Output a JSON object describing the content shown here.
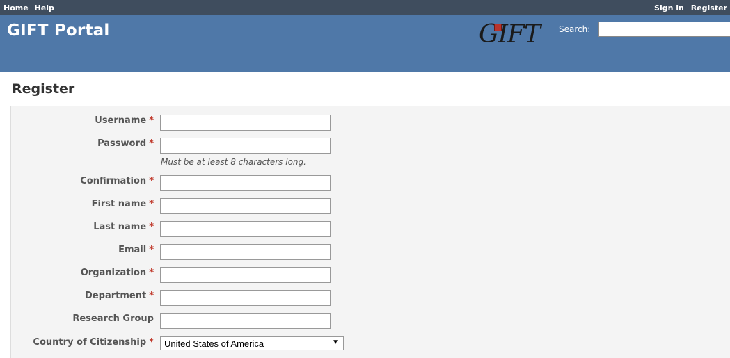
{
  "top_menu": {
    "home": "Home",
    "help": "Help",
    "sign_in": "Sign in",
    "register": "Register"
  },
  "header": {
    "title": "GIFT Portal",
    "logo_text": "GIFT",
    "search_label": "Search:",
    "search_value": ""
  },
  "page": {
    "title": "Register"
  },
  "form": {
    "required_mark": "*",
    "username_label": "Username",
    "password_label": "Password",
    "password_help": "Must be at least 8 characters long.",
    "confirmation_label": "Confirmation",
    "first_name_label": "First name",
    "last_name_label": "Last name",
    "email_label": "Email",
    "organization_label": "Organization",
    "department_label": "Department",
    "research_group_label": "Research Group",
    "country_label": "Country of Citizenship",
    "country_value": "United States of America",
    "values": {
      "username": "",
      "password": "",
      "confirmation": "",
      "first_name": "",
      "last_name": "",
      "email": "",
      "organization": "",
      "department": "",
      "research_group": ""
    }
  },
  "colors": {
    "top_bar": "#3f4d5e",
    "header": "#4f78a8",
    "required": "#c0392b",
    "form_bg": "#f4f4f4"
  }
}
